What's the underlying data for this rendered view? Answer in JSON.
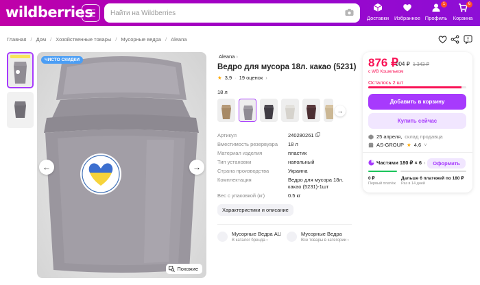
{
  "header": {
    "logo": "wildberries",
    "search_placeholder": "Найти на Wildberries",
    "nav": [
      {
        "label": "Доставки",
        "icon": "box-icon"
      },
      {
        "label": "Избранное",
        "icon": "heart-icon"
      },
      {
        "label": "Профиль",
        "icon": "user-icon",
        "badge": "1"
      },
      {
        "label": "Корзина",
        "icon": "cart-icon",
        "badge": "6"
      }
    ]
  },
  "breadcrumbs": [
    "Главная",
    "Дом",
    "Хозяйственные товары",
    "Мусорные ведра",
    "Aleana"
  ],
  "gallery": {
    "sale_tag": "ЧИСТО СКИДКИ",
    "similar_label": "Похожие"
  },
  "product": {
    "brand": "Aleana",
    "title": "Ведро для мусора 18л. какао (5231)",
    "rating": "3,9",
    "reviews": "19 оценок",
    "size": "18 л",
    "params": [
      {
        "name": "Артикул",
        "value": "240280261"
      },
      {
        "name": "Вместимость резервуара",
        "value": "18 л"
      },
      {
        "name": "Материал изделия",
        "value": "пластик"
      },
      {
        "name": "Тип установки",
        "value": "напольный"
      },
      {
        "name": "Страна производства",
        "value": "Украина"
      },
      {
        "name": "Комплектация",
        "value": "Ведро для мусора 18л. какао (5231)-1шт"
      },
      {
        "name": "Вес с упаковкой (кг)",
        "value": "0.5 кг"
      }
    ],
    "chars_button": "Характеристики и описание",
    "categories": [
      {
        "title": "Мусорные Ведра ALEANA",
        "sub": "В каталог бренда"
      },
      {
        "title": "Мусорные Ведра",
        "sub": "Все товары в категории"
      }
    ]
  },
  "buy": {
    "price": "876 ₽",
    "price_old1": "904 ₽",
    "price_old2": "1 343 ₽",
    "wallet": "с WB Кошельком",
    "stock": "Осталось 2 шт",
    "stock_level": 0.95,
    "add_to_cart": "Добавить в корзину",
    "buy_now": "Купить сейчас",
    "delivery_date": "25 апреля,",
    "delivery_seller": "склад продавца",
    "seller": "AS-GROUP",
    "seller_rating": "4,6",
    "installments": "Частями 180 ₽ × 6",
    "form_button": "Оформить",
    "pay_now_amount": "0 ₽",
    "pay_now_label": "Первый платёж",
    "pay_next_amount": "Дальше 6 платежей по 180 ₽",
    "pay_next_label": "Раз в 14 дней"
  },
  "colors": {
    "brand_gradient_start": "#c000a8",
    "brand_gradient_end": "#8d0fd6",
    "price": "#f91155",
    "accent": "#a73afd"
  }
}
